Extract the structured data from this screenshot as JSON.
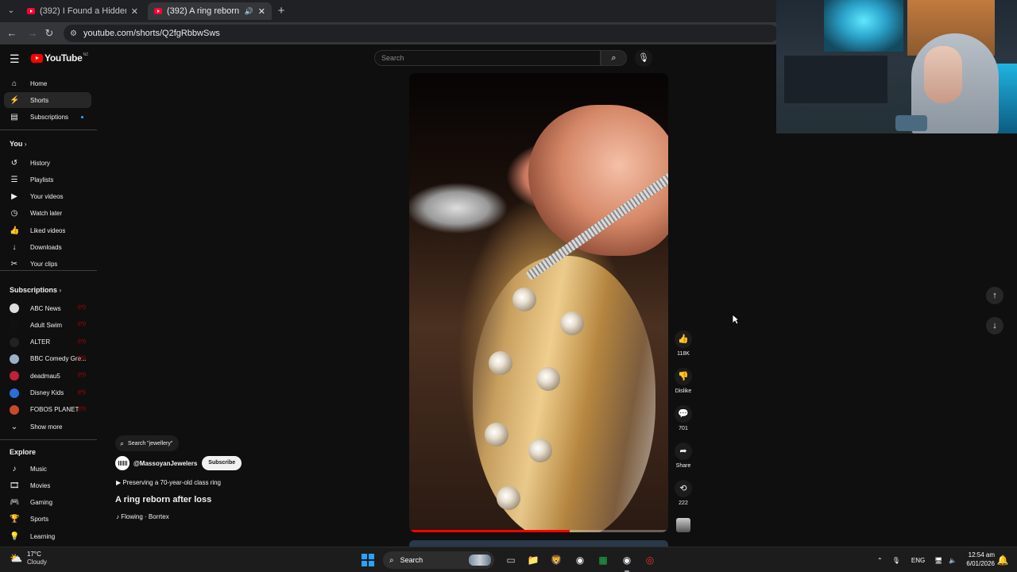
{
  "browser": {
    "tabs": [
      {
        "title": "(392) I Found a Hidden Gem in",
        "active": false
      },
      {
        "title": "(392) A ring reborn after loss",
        "active": true
      }
    ],
    "url": "youtube.com/shorts/Q2fgRbbwSws"
  },
  "youtube": {
    "logo": "YouTube",
    "region": "NZ",
    "search_placeholder": "Search"
  },
  "sidebar": {
    "main": [
      {
        "label": "Home",
        "icon": "home-icon",
        "glyph": "⌂"
      },
      {
        "label": "Shorts",
        "icon": "shorts-icon",
        "glyph": "⚡",
        "active": true
      },
      {
        "label": "Subscriptions",
        "icon": "subscriptions-icon",
        "glyph": "▤"
      }
    ],
    "you_heading": "You",
    "you": [
      {
        "label": "History",
        "icon": "history-icon",
        "glyph": "↺"
      },
      {
        "label": "Playlists",
        "icon": "playlists-icon",
        "glyph": "☰"
      },
      {
        "label": "Your videos",
        "icon": "your-videos-icon",
        "glyph": "▶"
      },
      {
        "label": "Watch later",
        "icon": "watch-later-icon",
        "glyph": "◷"
      },
      {
        "label": "Liked videos",
        "icon": "liked-videos-icon",
        "glyph": "👍"
      },
      {
        "label": "Downloads",
        "icon": "downloads-icon",
        "glyph": "↓"
      },
      {
        "label": "Your clips",
        "icon": "clips-icon",
        "glyph": "✂"
      }
    ],
    "subs_heading": "Subscriptions",
    "subscriptions": [
      {
        "label": "ABC News",
        "color": "#dddddd"
      },
      {
        "label": "Adult Swim",
        "color": "#111111"
      },
      {
        "label": "ALTER",
        "color": "#222222"
      },
      {
        "label": "BBC Comedy Gre...",
        "color": "#9ab0c8"
      },
      {
        "label": "deadmau5",
        "color": "#c0203a"
      },
      {
        "label": "Disney Kids",
        "color": "#2a6ed8"
      },
      {
        "label": "FOBOS PLANET",
        "color": "#c84a2a"
      }
    ],
    "show_more": "Show more",
    "explore_heading": "Explore",
    "explore": [
      {
        "label": "Music",
        "icon": "music-icon",
        "glyph": "♪"
      },
      {
        "label": "Movies",
        "icon": "movies-icon",
        "glyph": "🎞"
      },
      {
        "label": "Gaming",
        "icon": "gaming-icon",
        "glyph": "🎮"
      },
      {
        "label": "Sports",
        "icon": "sports-icon",
        "glyph": "🏆"
      },
      {
        "label": "Learning",
        "icon": "learning-icon",
        "glyph": "💡"
      }
    ]
  },
  "short": {
    "search_chip": "Search \"jewellery\"",
    "channel": "@MassoyanJewelers",
    "subscribe": "Subscribe",
    "playlist": "Preserving a 70-year-old class ring",
    "title": "A ring reborn after loss",
    "music": "Flowing · Borrtex",
    "progress": 0.62
  },
  "actions": {
    "likes": "118K",
    "dislike": "Dislike",
    "comments": "701",
    "share": "Share",
    "remix": "222"
  },
  "taskbar": {
    "temp": "17°C",
    "condition": "Cloudy",
    "search": "Search",
    "language": "ENG",
    "time": "12:54 am",
    "date": "6/01/2026"
  }
}
